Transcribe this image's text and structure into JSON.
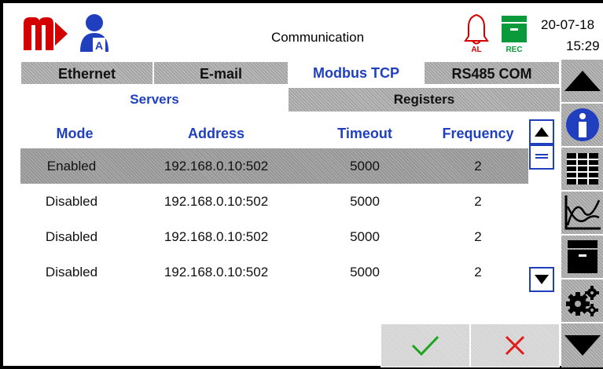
{
  "header": {
    "title": "Communication",
    "date": "20-07-18",
    "time": "15:29",
    "alarm_label": "AL",
    "rec_label": "REC",
    "user_badge": "A"
  },
  "tabs": [
    "Ethernet",
    "E-mail",
    "Modbus TCP",
    "RS485 COM"
  ],
  "active_tab": "Modbus TCP",
  "subtabs": [
    "Servers",
    "Registers"
  ],
  "active_subtab": "Servers",
  "table": {
    "columns": [
      "Mode",
      "Address",
      "Timeout",
      "Frequency"
    ],
    "rows": [
      {
        "mode": "Enabled",
        "address": "192.168.0.10:502",
        "timeout": "5000",
        "frequency": "2"
      },
      {
        "mode": "Disabled",
        "address": "192.168.0.10:502",
        "timeout": "5000",
        "frequency": "2"
      },
      {
        "mode": "Disabled",
        "address": "192.168.0.10:502",
        "timeout": "5000",
        "frequency": "2"
      },
      {
        "mode": "Disabled",
        "address": "192.168.0.10:502",
        "timeout": "5000",
        "frequency": "2"
      }
    ],
    "selected_row": 0
  },
  "side_buttons": [
    "up-arrow-icon",
    "info-icon",
    "table-icon",
    "chart-icon",
    "archive-icon",
    "settings-icon",
    "down-arrow-icon"
  ],
  "colors": {
    "accent": "#1f3fbf",
    "brand": "#d40000",
    "ok": "#1aa51a",
    "cancel": "#e21b1b",
    "rec": "#0a9a3c"
  }
}
